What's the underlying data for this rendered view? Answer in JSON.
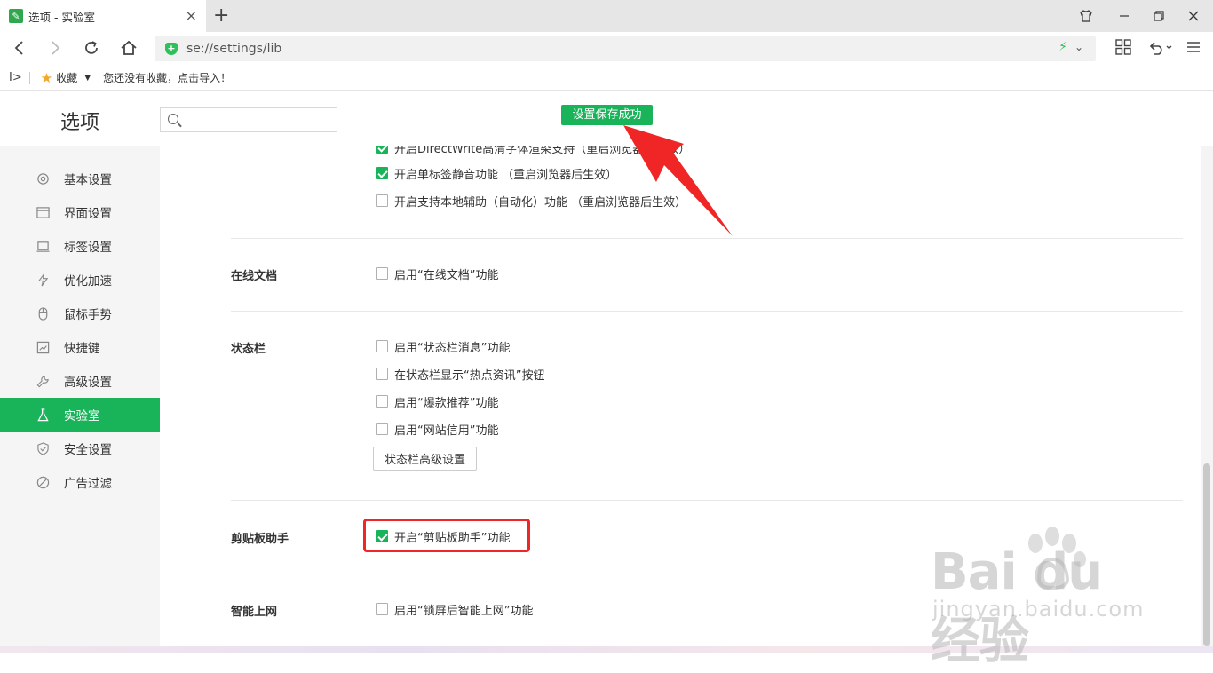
{
  "browser": {
    "tab_title": "选项 - 实验室",
    "favicon_glyph": "✎",
    "url": "se://settings/lib"
  },
  "bookmarks": {
    "label": "收藏",
    "empty_text": "您还没有收藏，点击导入！"
  },
  "settings": {
    "title": "选项",
    "search_placeholder": "",
    "toast": "设置保存成功"
  },
  "sidebar": {
    "items": [
      {
        "label": "基本设置",
        "icon": "gear-icon"
      },
      {
        "label": "界面设置",
        "icon": "window-icon"
      },
      {
        "label": "标签设置",
        "icon": "tab-icon"
      },
      {
        "label": "优化加速",
        "icon": "lightning-icon"
      },
      {
        "label": "鼠标手势",
        "icon": "mouse-icon"
      },
      {
        "label": "快捷键",
        "icon": "keyboard-icon"
      },
      {
        "label": "高级设置",
        "icon": "wrench-icon"
      },
      {
        "label": "实验室",
        "icon": "flask-icon",
        "active": true
      },
      {
        "label": "安全设置",
        "icon": "shield-icon"
      },
      {
        "label": "广告过滤",
        "icon": "block-icon"
      }
    ]
  },
  "content": {
    "top_options": [
      {
        "label": "开启DirectWrite高清字体渲染支持（重启浏览器后生效）",
        "checked": true
      },
      {
        "label": "开启单标签静音功能 （重启浏览器后生效）",
        "checked": true
      },
      {
        "label": "开启支持本地辅助（自动化）功能 （重启浏览器后生效）",
        "checked": false
      }
    ],
    "online_docs": {
      "label": "在线文档",
      "option": {
        "label": "启用“在线文档”功能",
        "checked": false
      }
    },
    "status_bar": {
      "label": "状态栏",
      "options": [
        {
          "label": "启用“状态栏消息”功能",
          "checked": false
        },
        {
          "label": "在状态栏显示“热点资讯”按钮",
          "checked": false
        },
        {
          "label": "启用“爆款推荐”功能",
          "checked": false
        },
        {
          "label": "启用“网站信用”功能",
          "checked": false
        }
      ],
      "button": "状态栏高级设置"
    },
    "clipboard": {
      "label": "剪贴板助手",
      "option": {
        "label": "开启“剪贴板助手”功能",
        "checked": true
      }
    },
    "smart_net": {
      "label": "智能上网",
      "option": {
        "label": "启用“锁屏后智能上网”功能",
        "checked": false
      }
    }
  },
  "watermark": {
    "main": "Bai du 经验",
    "sub": "jingyan.baidu.com"
  },
  "colors": {
    "accent": "#19b35a",
    "highlight": "#f02525"
  }
}
